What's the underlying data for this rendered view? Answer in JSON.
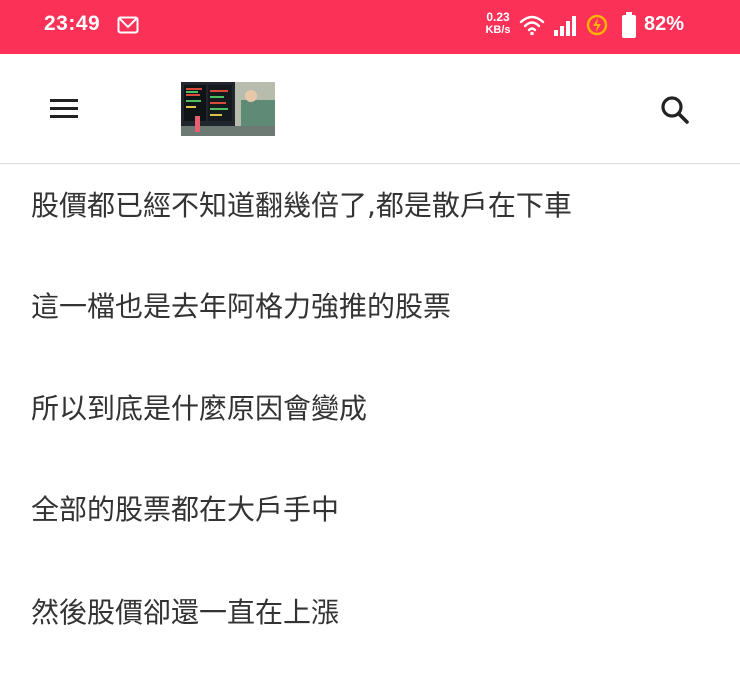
{
  "status_bar": {
    "time": "23:49",
    "net_speed_value": "0.23",
    "net_speed_unit": "KB/s",
    "battery_percent": "82%",
    "icons": [
      "mail-icon",
      "wifi-icon",
      "signal-icon",
      "battery-saver-icon",
      "battery-icon"
    ],
    "background_color": "#fb3158"
  },
  "app_bar": {
    "icons": [
      "menu-icon",
      "site-logo",
      "search-icon"
    ]
  },
  "article": {
    "lines": [
      "股價都已經不知道翻幾倍了,都是散戶在下車",
      "這一檔也是去年阿格力強推的股票",
      "所以到底是什麼原因會變成",
      "全部的股票都在大戶手中",
      "然後股價卻還一直在上漲"
    ]
  }
}
